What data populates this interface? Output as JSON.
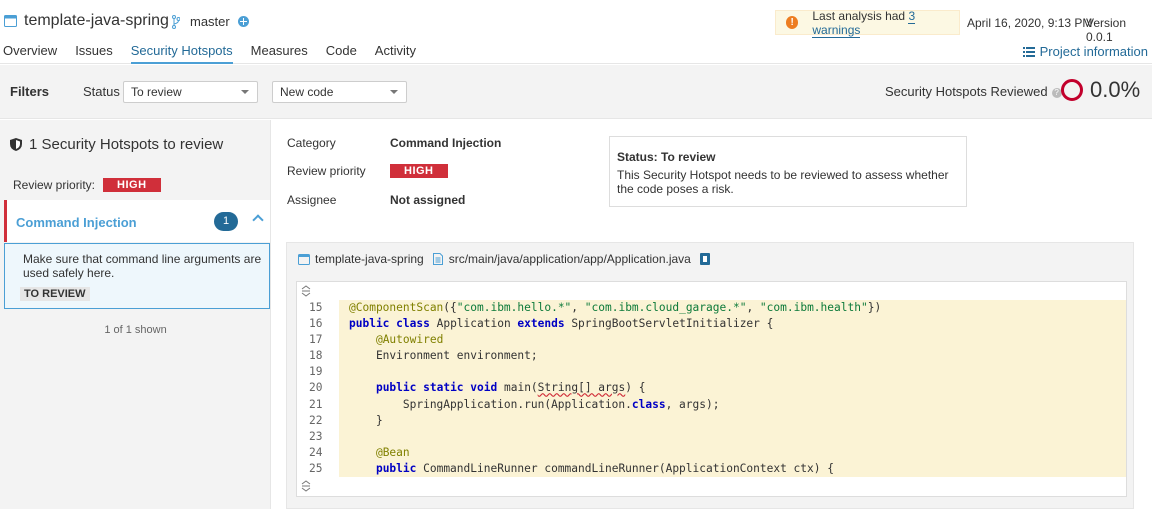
{
  "header": {
    "project_name": "template-java-spring",
    "branch": "master",
    "warning": {
      "prefix": "Last analysis had ",
      "link": "3 warnings"
    },
    "analysis_date": "April 16, 2020, 9:13 PM",
    "version": "Version 0.0.1",
    "project_info": "Project information"
  },
  "nav": {
    "tabs": [
      {
        "label": "Overview",
        "active": false
      },
      {
        "label": "Issues",
        "active": false
      },
      {
        "label": "Security Hotspots",
        "active": true
      },
      {
        "label": "Measures",
        "active": false
      },
      {
        "label": "Code",
        "active": false
      },
      {
        "label": "Activity",
        "active": false
      }
    ]
  },
  "filters": {
    "title": "Filters",
    "status_label": "Status",
    "status_value": "To review",
    "period_value": "New code",
    "reviewed_label": "Security Hotspots Reviewed",
    "reviewed_pct": "0.0%"
  },
  "sidebar": {
    "title": "1 Security Hotspots to review",
    "review_priority_label": "Review priority:",
    "review_priority_value": "HIGH",
    "category": {
      "name": "Command Injection",
      "count": "1"
    },
    "hotspot": {
      "message": "Make sure that command line arguments are used safely here.",
      "status": "TO REVIEW"
    },
    "shown": "1 of 1 shown"
  },
  "details": {
    "category_label": "Category",
    "category_value": "Command Injection",
    "priority_label": "Review priority",
    "priority_value": "HIGH",
    "assignee_label": "Assignee",
    "assignee_value": "Not assigned",
    "status_title": "Status: To review",
    "status_desc": "This Security Hotspot needs to be reviewed to assess whether the code poses a risk."
  },
  "code": {
    "project": "template-java-spring",
    "file_path": "src/main/java/application/app/Application.java",
    "lines": [
      {
        "n": "15",
        "text": "@ComponentScan({\"com.ibm.hello.*\", \"com.ibm.cloud_garage.*\", \"com.ibm.health\"})"
      },
      {
        "n": "16",
        "text": "public class Application extends SpringBootServletInitializer {"
      },
      {
        "n": "17",
        "text": "    @Autowired"
      },
      {
        "n": "18",
        "text": "    Environment environment;"
      },
      {
        "n": "19",
        "text": ""
      },
      {
        "n": "20",
        "text": "    public static void main(String[] args) {"
      },
      {
        "n": "21",
        "text": "        SpringApplication.run(Application.class, args);"
      },
      {
        "n": "22",
        "text": "    }"
      },
      {
        "n": "23",
        "text": ""
      },
      {
        "n": "24",
        "text": "    @Bean"
      },
      {
        "n": "25",
        "text": "    public CommandLineRunner commandLineRunner(ApplicationContext ctx) {"
      }
    ]
  },
  "colors": {
    "accent": "#236a97",
    "link": "#4b9fd5",
    "high": "#d02f3a",
    "code_highlight": "#fbf3d5"
  }
}
